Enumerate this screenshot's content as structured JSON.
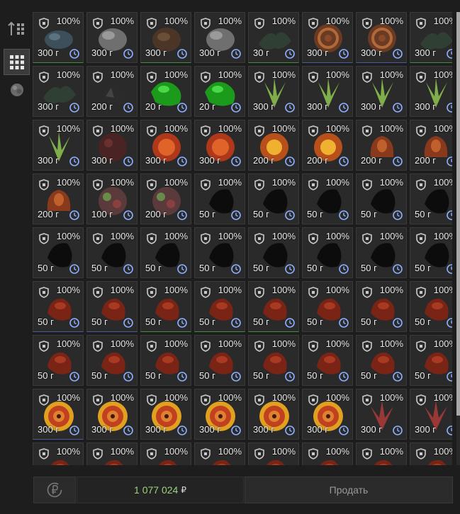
{
  "sidebar": {
    "items": [
      {
        "name": "sort-icon",
        "active": false
      },
      {
        "name": "grid-view-icon",
        "active": true
      },
      {
        "name": "category-icon",
        "active": false
      }
    ]
  },
  "grid": {
    "clock_icon": "clock-icon",
    "shield_icon": "shield-icon",
    "cells": [
      {
        "pct": "100%",
        "weight": "300 г",
        "art": "fish",
        "quality": "green"
      },
      {
        "pct": "100%",
        "weight": "300 г",
        "art": "rock",
        "quality": ""
      },
      {
        "pct": "100%",
        "weight": "300 г",
        "art": "shell",
        "quality": "green"
      },
      {
        "pct": "100%",
        "weight": "300 г",
        "art": "rock",
        "quality": ""
      },
      {
        "pct": "100%",
        "weight": "30 г",
        "art": "leafy",
        "quality": "green"
      },
      {
        "pct": "100%",
        "weight": "300 г",
        "art": "coil",
        "quality": "blue"
      },
      {
        "pct": "100%",
        "weight": "300 г",
        "art": "coil",
        "quality": "blue"
      },
      {
        "pct": "100%",
        "weight": "300 г",
        "art": "leafy",
        "quality": "green"
      },
      {
        "pct": "100%",
        "weight": "300 г",
        "art": "leafy",
        "quality": ""
      },
      {
        "pct": "100%",
        "weight": "200 г",
        "art": "claw",
        "quality": ""
      },
      {
        "pct": "100%",
        "weight": "20 г",
        "art": "green",
        "quality": ""
      },
      {
        "pct": "100%",
        "weight": "20 г",
        "art": "green",
        "quality": ""
      },
      {
        "pct": "100%",
        "weight": "300 г",
        "art": "spike",
        "quality": ""
      },
      {
        "pct": "100%",
        "weight": "300 г",
        "art": "spike",
        "quality": ""
      },
      {
        "pct": "100%",
        "weight": "300 г",
        "art": "spike",
        "quality": ""
      },
      {
        "pct": "100%",
        "weight": "300 г",
        "art": "spike",
        "quality": ""
      },
      {
        "pct": "100%",
        "weight": "300 г",
        "art": "spike",
        "quality": ""
      },
      {
        "pct": "100%",
        "weight": "300 г",
        "art": "berry",
        "quality": ""
      },
      {
        "pct": "100%",
        "weight": "300 г",
        "art": "ball",
        "quality": ""
      },
      {
        "pct": "100%",
        "weight": "300 г",
        "art": "ball",
        "quality": ""
      },
      {
        "pct": "100%",
        "weight": "200 г",
        "art": "sun",
        "quality": ""
      },
      {
        "pct": "100%",
        "weight": "200 г",
        "art": "sun",
        "quality": ""
      },
      {
        "pct": "100%",
        "weight": "200 г",
        "art": "flesh",
        "quality": ""
      },
      {
        "pct": "100%",
        "weight": "200 г",
        "art": "flesh",
        "quality": ""
      },
      {
        "pct": "100%",
        "weight": "200 г",
        "art": "flesh",
        "quality": ""
      },
      {
        "pct": "100%",
        "weight": "100 г",
        "art": "mixed",
        "quality": ""
      },
      {
        "pct": "100%",
        "weight": "200 г",
        "art": "mixed",
        "quality": ""
      },
      {
        "pct": "100%",
        "weight": "50 г",
        "art": "dark",
        "quality": ""
      },
      {
        "pct": "100%",
        "weight": "50 г",
        "art": "dark",
        "quality": ""
      },
      {
        "pct": "100%",
        "weight": "50 г",
        "art": "dark",
        "quality": ""
      },
      {
        "pct": "100%",
        "weight": "50 г",
        "art": "dark",
        "quality": ""
      },
      {
        "pct": "100%",
        "weight": "50 г",
        "art": "dark",
        "quality": ""
      },
      {
        "pct": "100%",
        "weight": "50 г",
        "art": "dark",
        "quality": ""
      },
      {
        "pct": "100%",
        "weight": "50 г",
        "art": "dark",
        "quality": ""
      },
      {
        "pct": "100%",
        "weight": "50 г",
        "art": "dark",
        "quality": ""
      },
      {
        "pct": "100%",
        "weight": "50 г",
        "art": "dark",
        "quality": ""
      },
      {
        "pct": "100%",
        "weight": "50 г",
        "art": "dark",
        "quality": ""
      },
      {
        "pct": "100%",
        "weight": "50 г",
        "art": "dark",
        "quality": ""
      },
      {
        "pct": "100%",
        "weight": "50 г",
        "art": "dark",
        "quality": ""
      },
      {
        "pct": "100%",
        "weight": "50 г",
        "art": "dark",
        "quality": ""
      },
      {
        "pct": "100%",
        "weight": "50 г",
        "art": "red",
        "quality": "blue"
      },
      {
        "pct": "100%",
        "weight": "50 г",
        "art": "red",
        "quality": "blue"
      },
      {
        "pct": "100%",
        "weight": "50 г",
        "art": "red",
        "quality": "green"
      },
      {
        "pct": "100%",
        "weight": "50 г",
        "art": "red",
        "quality": "green"
      },
      {
        "pct": "100%",
        "weight": "50 г",
        "art": "red",
        "quality": "green"
      },
      {
        "pct": "100%",
        "weight": "50 г",
        "art": "red",
        "quality": ""
      },
      {
        "pct": "100%",
        "weight": "50 г",
        "art": "red",
        "quality": ""
      },
      {
        "pct": "100%",
        "weight": "50 г",
        "art": "red",
        "quality": ""
      },
      {
        "pct": "100%",
        "weight": "50 г",
        "art": "red",
        "quality": ""
      },
      {
        "pct": "100%",
        "weight": "50 г",
        "art": "red",
        "quality": ""
      },
      {
        "pct": "100%",
        "weight": "50 г",
        "art": "red",
        "quality": ""
      },
      {
        "pct": "100%",
        "weight": "50 г",
        "art": "red",
        "quality": ""
      },
      {
        "pct": "100%",
        "weight": "50 г",
        "art": "red",
        "quality": ""
      },
      {
        "pct": "100%",
        "weight": "50 г",
        "art": "red",
        "quality": ""
      },
      {
        "pct": "100%",
        "weight": "50 г",
        "art": "red",
        "quality": ""
      },
      {
        "pct": "100%",
        "weight": "50 г",
        "art": "red",
        "quality": ""
      },
      {
        "pct": "100%",
        "weight": "300 г",
        "art": "swirl",
        "quality": "blue"
      },
      {
        "pct": "100%",
        "weight": "300 г",
        "art": "swirl",
        "quality": ""
      },
      {
        "pct": "100%",
        "weight": "300 г",
        "art": "swirl",
        "quality": ""
      },
      {
        "pct": "100%",
        "weight": "300 г",
        "art": "swirl",
        "quality": ""
      },
      {
        "pct": "100%",
        "weight": "300 г",
        "art": "swirl",
        "quality": ""
      },
      {
        "pct": "100%",
        "weight": "300 г",
        "art": "swirl",
        "quality": ""
      },
      {
        "pct": "100%",
        "weight": "300 г",
        "art": "crystal",
        "quality": ""
      },
      {
        "pct": "100%",
        "weight": "300 г",
        "art": "crystal",
        "quality": ""
      },
      {
        "pct": "100%",
        "weight": "",
        "art": "red",
        "quality": "green"
      },
      {
        "pct": "100%",
        "weight": "",
        "art": "red",
        "quality": ""
      },
      {
        "pct": "100%",
        "weight": "",
        "art": "red",
        "quality": ""
      },
      {
        "pct": "100%",
        "weight": "",
        "art": "red",
        "quality": ""
      },
      {
        "pct": "100%",
        "weight": "",
        "art": "red",
        "quality": ""
      },
      {
        "pct": "100%",
        "weight": "",
        "art": "red",
        "quality": ""
      },
      {
        "pct": "100%",
        "weight": "",
        "art": "red",
        "quality": ""
      },
      {
        "pct": "100%",
        "weight": "",
        "art": "red",
        "quality": ""
      }
    ]
  },
  "footer": {
    "refresh_icon": "refresh-ruble-icon",
    "total_amount": "1 077 024",
    "currency": "₽",
    "sell_label": "Продать"
  },
  "colors": {
    "total": "#9ed27e",
    "quality_green": "#3f8f3f",
    "quality_blue": "#4a5aa0"
  }
}
